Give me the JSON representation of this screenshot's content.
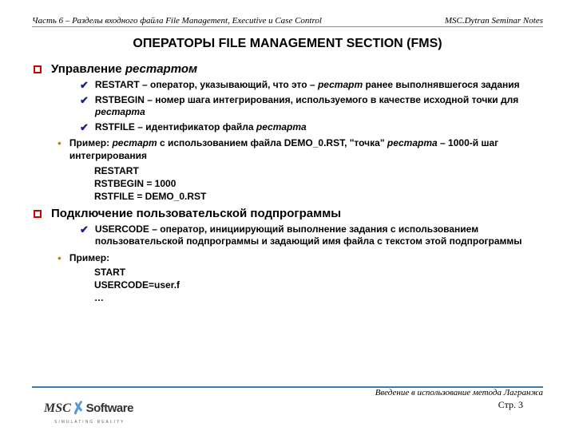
{
  "header": {
    "left": "Часть 6 – Разделы входного файла File Management, Executive и Case Control",
    "right": "MSC.Dytran Seminar Notes"
  },
  "title": "ОПЕРАТОРЫ FILE MANAGEMENT SECTION (FMS)",
  "sections": [
    {
      "heading_plain": "Управление",
      "heading_italic": "рестартом",
      "checks": [
        {
          "bold": "RESTART",
          "rest": " – оператор, указывающий, что это – ",
          "italic": "рестарт",
          "tail": " ранее выполнявшегося задания"
        },
        {
          "bold": "RSTBEGIN",
          "rest": " – номер шага интегрирования, используемого в качестве исходной точки для ",
          "italic": "рестарта",
          "tail": ""
        },
        {
          "bold": "RSTFILE",
          "rest": " – идентификатор файла ",
          "italic": "рестарта",
          "tail": ""
        }
      ],
      "example": {
        "label_pre": "Пример: ",
        "italic1": "рестарт",
        "mid": " с использованием файла DEMO_0.RST, \"точка\" ",
        "italic2": "рестарта",
        "tail": " – 1000-й шаг интегрирования",
        "code": [
          "RESTART",
          "RSTBEGIN = 1000",
          "RSTFILE = DEMO_0.RST"
        ]
      }
    },
    {
      "heading_plain": "Подключение пользовательской подпрограммы",
      "heading_italic": "",
      "checks": [
        {
          "bold": "USERCODE",
          "rest": " – оператор, инициирующий выполнение задания с использованием пользовательской подпрограммы и задающий имя файла с текстом этой подпрограммы",
          "italic": "",
          "tail": ""
        }
      ],
      "example": {
        "label_pre": "Пример:",
        "italic1": "",
        "mid": "",
        "italic2": "",
        "tail": "",
        "code": [
          "START",
          "USERCODE=user.f",
          "…"
        ]
      }
    }
  ],
  "footer": {
    "logo_left": "MSC",
    "logo_right": "Software",
    "logo_sub": "SIMULATING REALITY",
    "caption": "Введение в использование метода Лагранжа",
    "page": "Стр. 3"
  }
}
